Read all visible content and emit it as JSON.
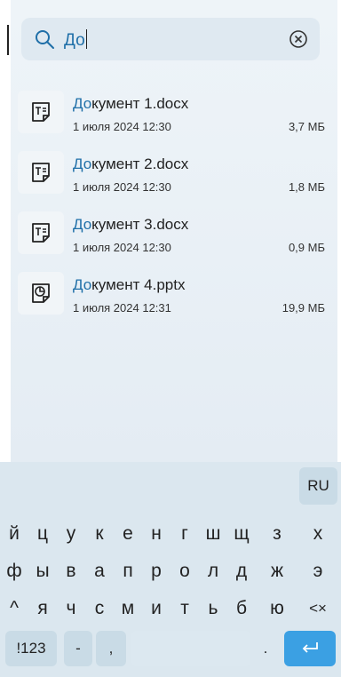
{
  "search": {
    "query": "До"
  },
  "files": [
    {
      "name_prefix": "До",
      "name_rest": "кумент 1.docx",
      "date": "1 июля 2024 12:30",
      "size": "3,7 МБ",
      "icon": "document-text-icon"
    },
    {
      "name_prefix": "До",
      "name_rest": "кумент 2.docx",
      "date": "1 июля 2024 12:30",
      "size": "1,8 МБ",
      "icon": "document-text-icon"
    },
    {
      "name_prefix": "До",
      "name_rest": "кумент 3.docx",
      "date": "1 июля 2024 12:30",
      "size": "0,9 МБ",
      "icon": "document-text-icon"
    },
    {
      "name_prefix": "До",
      "name_rest": "кумент 4.pptx",
      "date": "1 июля 2024 12:31",
      "size": "19,9 МБ",
      "icon": "presentation-icon"
    }
  ],
  "keyboard": {
    "lang": "RU",
    "row1": [
      "й",
      "ц",
      "у",
      "к",
      "е",
      "н",
      "г",
      "ш",
      "щ",
      "з",
      "х"
    ],
    "row2": [
      "ф",
      "ы",
      "в",
      "а",
      "п",
      "р",
      "о",
      "л",
      "д",
      "ж",
      "э"
    ],
    "row3": [
      "я",
      "ч",
      "с",
      "м",
      "и",
      "т",
      "ь",
      "б",
      "ю"
    ],
    "shift": "^",
    "backspace": "<×",
    "sym": "!123",
    "minus": "-",
    "comma": ",",
    "period": "."
  },
  "colors": {
    "accent": "#1f6fa8",
    "enter_key": "#3ba0e3"
  }
}
